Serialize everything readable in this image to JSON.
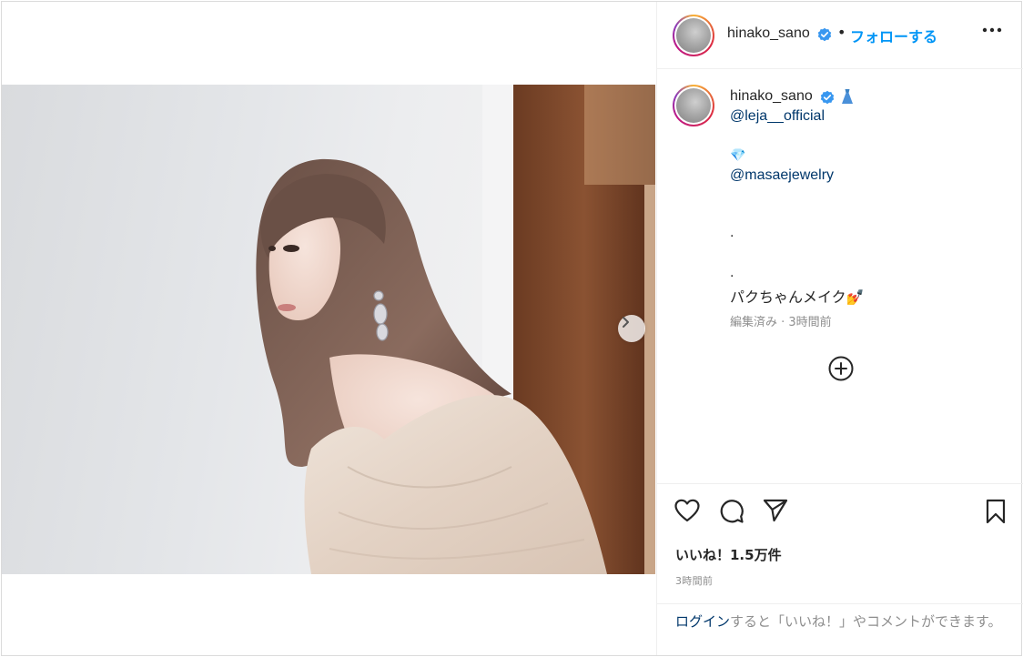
{
  "post": {
    "username": "hinako_sano",
    "follow_label": "フォローする",
    "separator": "•",
    "caption": {
      "username": "hinako_sano",
      "lines": [
        {
          "text": "@leja__official",
          "type": "link"
        },
        {
          "text": "💎",
          "type": "emoji"
        },
        {
          "text": "@masaejewelry",
          "type": "link"
        },
        {
          "text": ".",
          "type": "text"
        },
        {
          "text": ".",
          "type": "text"
        },
        {
          "text": "パクちゃんメイク💅",
          "type": "text"
        }
      ],
      "meta": "編集済み · 3時間前"
    },
    "likes": "いいね！1.5万件",
    "timestamp": "3時間前",
    "login_prompt": {
      "link": "ログイン",
      "rest": "すると「いいね！」やコメントができます。"
    }
  },
  "icons": {
    "verified": "verified-badge-icon",
    "more": "more-options-icon",
    "dress": "dress-emoji",
    "next": "chevron-right-icon",
    "add": "add-circle-icon",
    "like": "heart-icon",
    "comment": "comment-icon",
    "share": "share-icon",
    "save": "bookmark-icon"
  },
  "colors": {
    "accent": "#0095f6",
    "link": "#00376b",
    "muted": "#8e8e8e",
    "text": "#262626"
  }
}
